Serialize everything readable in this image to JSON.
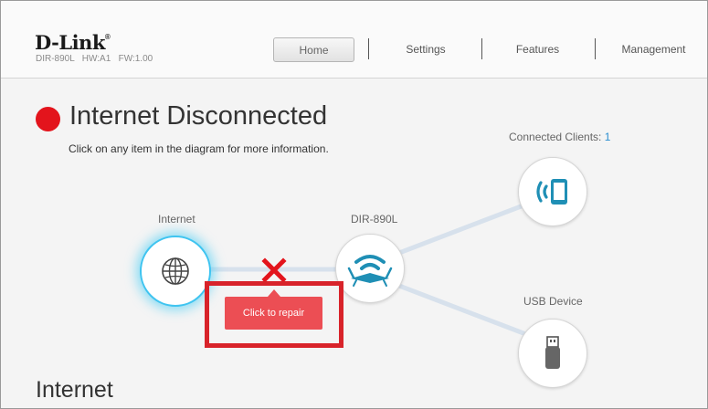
{
  "header": {
    "logo": "D-Link",
    "logo_mark": "®",
    "device_info": "DIR-890L   HW:A1   FW:1.00",
    "nav": {
      "home": "Home",
      "settings": "Settings",
      "features": "Features",
      "management": "Management"
    }
  },
  "status": {
    "title": "Internet Disconnected",
    "color": "#e3141c",
    "instruction": "Click on any item in the diagram for more information."
  },
  "diagram": {
    "internet_label": "Internet",
    "router_label": "DIR-890L",
    "clients_label": "Connected Clients: ",
    "clients_count": "1",
    "usb_label": "USB Device",
    "repair_button": "Click to repair",
    "icons": {
      "internet": "globe-icon",
      "router": "router-icon",
      "clients": "wireless-device-icon",
      "usb": "usb-drive-icon",
      "disconnect": "disconnect-x-icon"
    },
    "colors": {
      "accent": "#1f8fb5",
      "disconnect": "#e3141c",
      "repair": "#ec4e54",
      "highlight": "#d8232a"
    }
  },
  "section": {
    "heading": "Internet"
  }
}
